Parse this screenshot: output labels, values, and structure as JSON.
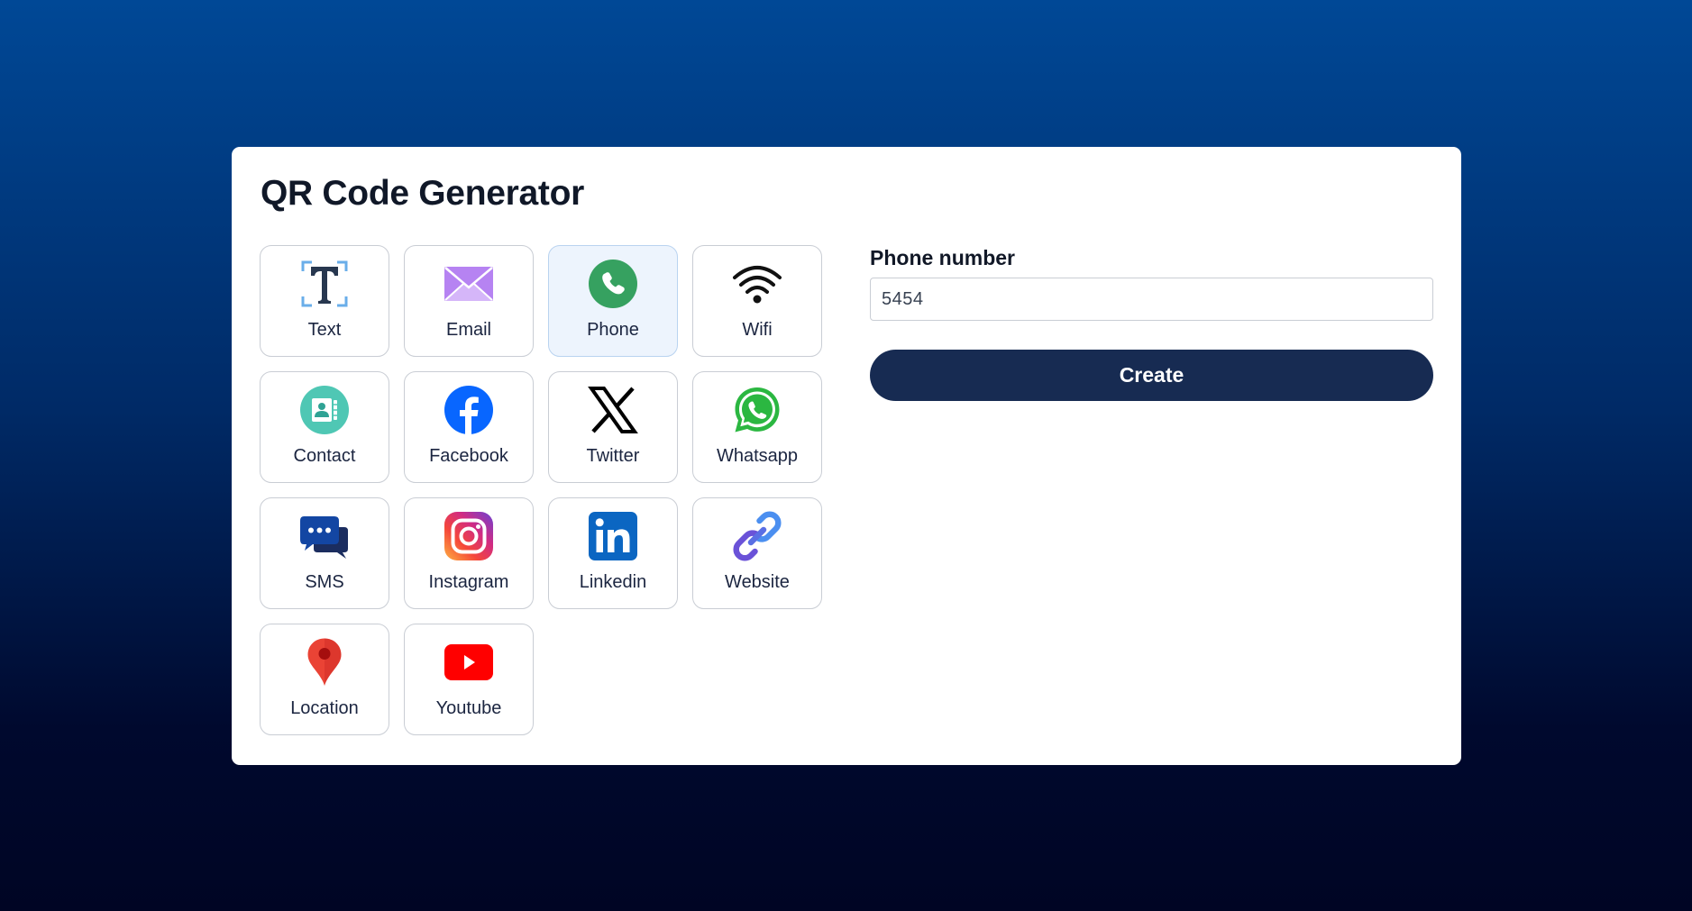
{
  "app": {
    "title": "QR Code Generator"
  },
  "types": [
    {
      "label": "Text",
      "icon": "text-icon",
      "selected": false
    },
    {
      "label": "Email",
      "icon": "envelope-icon",
      "selected": false
    },
    {
      "label": "Phone",
      "icon": "phone-icon",
      "selected": true
    },
    {
      "label": "Wifi",
      "icon": "wifi-icon",
      "selected": false
    },
    {
      "label": "Contact",
      "icon": "contact-card-icon",
      "selected": false
    },
    {
      "label": "Facebook",
      "icon": "facebook-icon",
      "selected": false
    },
    {
      "label": "Twitter",
      "icon": "x-twitter-icon",
      "selected": false
    },
    {
      "label": "Whatsapp",
      "icon": "whatsapp-icon",
      "selected": false
    },
    {
      "label": "SMS",
      "icon": "chat-bubbles-icon",
      "selected": false
    },
    {
      "label": "Instagram",
      "icon": "instagram-icon",
      "selected": false
    },
    {
      "label": "Linkedin",
      "icon": "linkedin-icon",
      "selected": false
    },
    {
      "label": "Website",
      "icon": "link-icon",
      "selected": false
    },
    {
      "label": "Location",
      "icon": "map-pin-icon",
      "selected": false
    },
    {
      "label": "Youtube",
      "icon": "youtube-icon",
      "selected": false
    }
  ],
  "form": {
    "field_label": "Phone number",
    "phone_value": "5454",
    "create_label": "Create"
  },
  "colors": {
    "background_top": "#004896",
    "background_bottom": "#000524",
    "button": "#172b52",
    "selected_tile": "#edf4fd"
  }
}
